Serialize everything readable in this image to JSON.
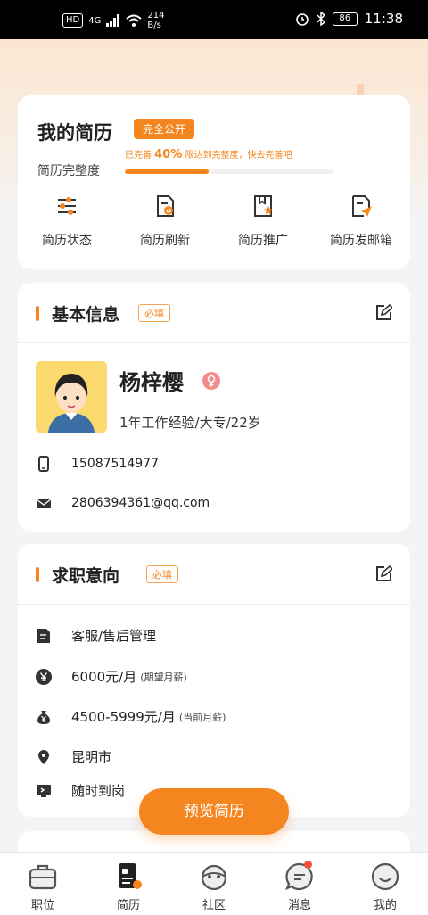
{
  "status_bar": {
    "hd": "HD",
    "net": "4G",
    "speed_value": "214",
    "speed_unit": "B/s",
    "battery": "86",
    "time": "11:38"
  },
  "resume": {
    "title": "我的简历",
    "public_badge": "完全公开",
    "completeness_label": "简历完整度",
    "tip_prefix": "已完善",
    "tip_percent": "40%",
    "tip_suffix": "限达到完整度，快去完善吧",
    "progress": 0.4,
    "quick_actions": [
      {
        "label": "简历状态",
        "icon": "sliders-icon"
      },
      {
        "label": "简历刷新",
        "icon": "refresh-doc-icon"
      },
      {
        "label": "简历推广",
        "icon": "star-doc-icon"
      },
      {
        "label": "简历发邮箱",
        "icon": "send-doc-icon"
      }
    ]
  },
  "basic_info": {
    "title": "基本信息",
    "required": "必填",
    "name": "杨梓樱",
    "summary": "1年工作经验/大专/22岁",
    "phone": "15087514977",
    "email": "2806394361@qq.com"
  },
  "intent": {
    "title": "求职意向",
    "required": "必填",
    "position": "客服/售后管理",
    "expected_salary": "6000元/月",
    "expected_note": "(期望月薪)",
    "current_salary": "4500-5999元/月",
    "current_note": "(当前月薪)",
    "city": "昆明市",
    "availability": "随时到岗"
  },
  "preview_button": "预览简历",
  "tabs": [
    {
      "label": "职位",
      "icon": "briefcase-icon"
    },
    {
      "label": "简历",
      "icon": "resume-icon",
      "active": true
    },
    {
      "label": "社区",
      "icon": "community-icon"
    },
    {
      "label": "消息",
      "icon": "message-icon",
      "badge": true
    },
    {
      "label": "我的",
      "icon": "profile-icon"
    }
  ],
  "colors": {
    "accent": "#f5861f",
    "badge_red": "#f0523b"
  }
}
